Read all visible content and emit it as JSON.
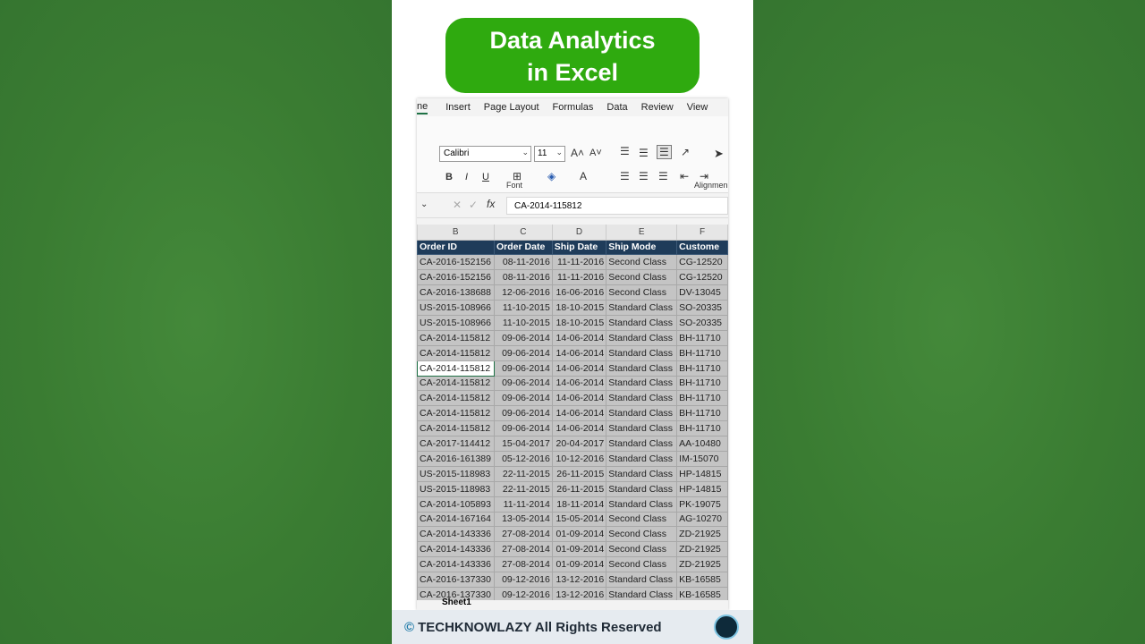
{
  "title": {
    "line1": "Data Analytics",
    "line2": "in Excel"
  },
  "menu": {
    "tabs": [
      "ne",
      "Insert",
      "Page Layout",
      "Formulas",
      "Data",
      "Review",
      "View"
    ]
  },
  "ribbon": {
    "font_name": "Calibri",
    "font_size": "11",
    "font_group_label": "Font",
    "alignment_group_label": "Alignmen"
  },
  "formula": {
    "value": "CA-2014-115812"
  },
  "grid": {
    "col_letters": [
      "B",
      "C",
      "D",
      "E",
      "F"
    ],
    "headers": [
      "Order ID",
      "Order Date",
      "Ship Date",
      "Ship Mode",
      "Custome"
    ],
    "rows": [
      [
        "CA-2016-152156",
        "08-11-2016",
        "11-11-2016",
        "Second Class",
        "CG-12520"
      ],
      [
        "CA-2016-152156",
        "08-11-2016",
        "11-11-2016",
        "Second Class",
        "CG-12520"
      ],
      [
        "CA-2016-138688",
        "12-06-2016",
        "16-06-2016",
        "Second Class",
        "DV-13045"
      ],
      [
        "US-2015-108966",
        "11-10-2015",
        "18-10-2015",
        "Standard Class",
        "SO-20335"
      ],
      [
        "US-2015-108966",
        "11-10-2015",
        "18-10-2015",
        "Standard Class",
        "SO-20335"
      ],
      [
        "CA-2014-115812",
        "09-06-2014",
        "14-06-2014",
        "Standard Class",
        "BH-11710"
      ],
      [
        "CA-2014-115812",
        "09-06-2014",
        "14-06-2014",
        "Standard Class",
        "BH-11710"
      ],
      [
        "CA-2014-115812",
        "09-06-2014",
        "14-06-2014",
        "Standard Class",
        "BH-11710"
      ],
      [
        "CA-2014-115812",
        "09-06-2014",
        "14-06-2014",
        "Standard Class",
        "BH-11710"
      ],
      [
        "CA-2014-115812",
        "09-06-2014",
        "14-06-2014",
        "Standard Class",
        "BH-11710"
      ],
      [
        "CA-2014-115812",
        "09-06-2014",
        "14-06-2014",
        "Standard Class",
        "BH-11710"
      ],
      [
        "CA-2014-115812",
        "09-06-2014",
        "14-06-2014",
        "Standard Class",
        "BH-11710"
      ],
      [
        "CA-2017-114412",
        "15-04-2017",
        "20-04-2017",
        "Standard Class",
        "AA-10480"
      ],
      [
        "CA-2016-161389",
        "05-12-2016",
        "10-12-2016",
        "Standard Class",
        "IM-15070"
      ],
      [
        "US-2015-118983",
        "22-11-2015",
        "26-11-2015",
        "Standard Class",
        "HP-14815"
      ],
      [
        "US-2015-118983",
        "22-11-2015",
        "26-11-2015",
        "Standard Class",
        "HP-14815"
      ],
      [
        "CA-2014-105893",
        "11-11-2014",
        "18-11-2014",
        "Standard Class",
        "PK-19075"
      ],
      [
        "CA-2014-167164",
        "13-05-2014",
        "15-05-2014",
        "Second Class",
        "AG-10270"
      ],
      [
        "CA-2014-143336",
        "27-08-2014",
        "01-09-2014",
        "Second Class",
        "ZD-21925"
      ],
      [
        "CA-2014-143336",
        "27-08-2014",
        "01-09-2014",
        "Second Class",
        "ZD-21925"
      ],
      [
        "CA-2014-143336",
        "27-08-2014",
        "01-09-2014",
        "Second Class",
        "ZD-21925"
      ],
      [
        "CA-2016-137330",
        "09-12-2016",
        "13-12-2016",
        "Standard Class",
        "KB-16585"
      ],
      [
        "CA-2016-137330",
        "09-12-2016",
        "13-12-2016",
        "Standard Class",
        "KB-16585"
      ]
    ],
    "selected_row": 7
  },
  "sheet": {
    "tab": "Sheet1"
  },
  "footer": {
    "text": "TECHKNOWLAZY All Rights Reserved"
  }
}
